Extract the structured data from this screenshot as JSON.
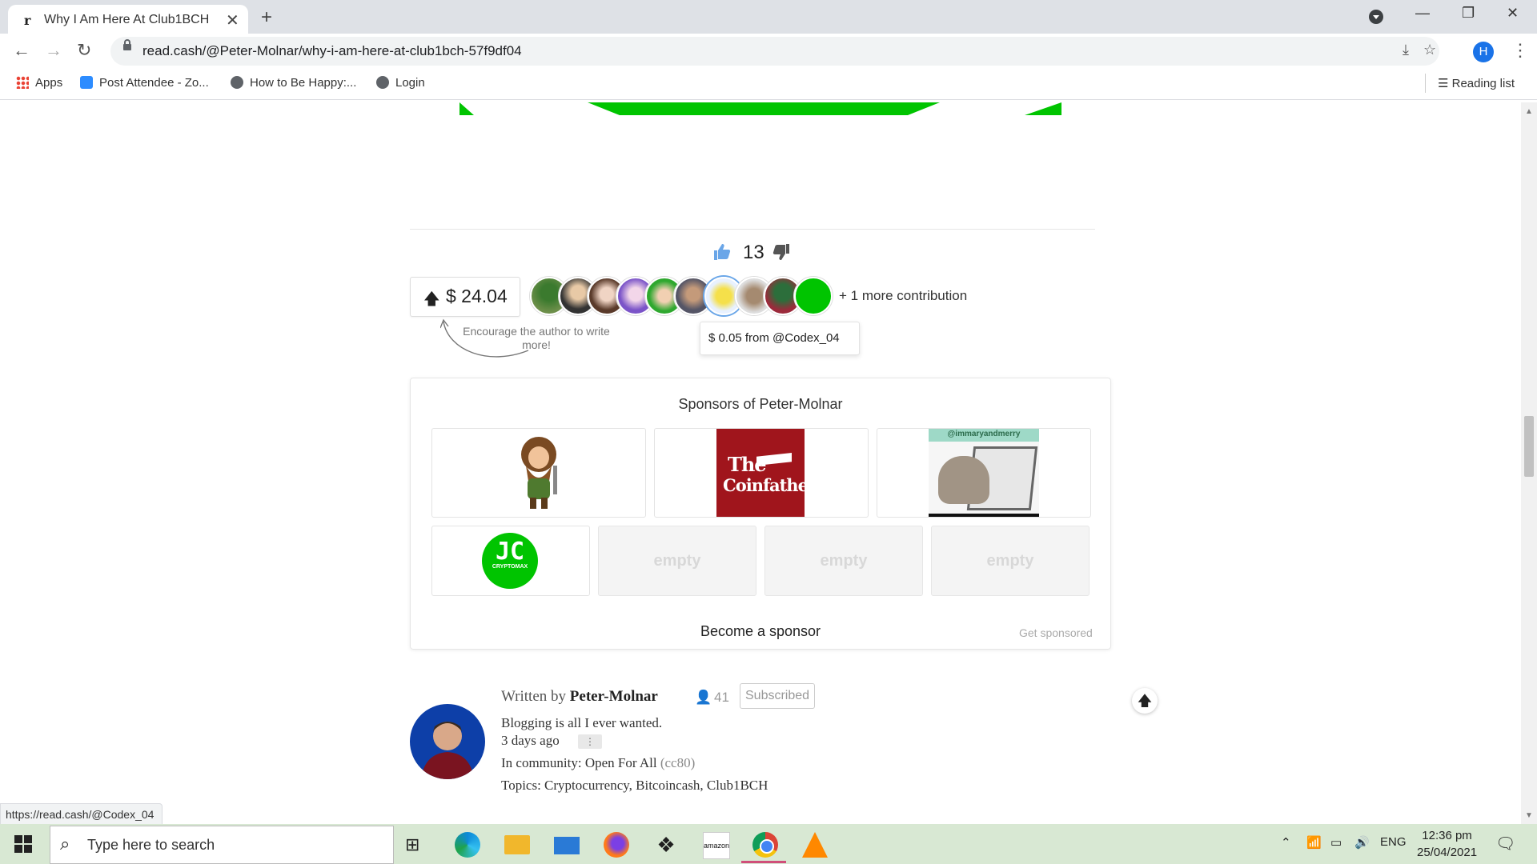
{
  "browser": {
    "tab_title": "Why I Am Here At Club1BCH",
    "tab_favicon": "r",
    "url": "read.cash/@Peter-Molnar/why-i-am-here-at-club1bch-57f9df04",
    "profile_initial": "H",
    "bookmarks": [
      {
        "label": "Apps",
        "icon": "apps-grid-icon"
      },
      {
        "label": "Post Attendee - Zo...",
        "icon": "zoom-icon"
      },
      {
        "label": "How to Be Happy:...",
        "icon": "globe-icon"
      },
      {
        "label": "Login",
        "icon": "globe-icon"
      }
    ],
    "reading_list": "Reading list",
    "status_url": "https://read.cash/@Codex_04"
  },
  "article": {
    "votes": "13",
    "tip_amount": "$ 24.04",
    "encourage_text": "Encourage the author to write more!",
    "more_contributions": "+ 1 more contribution",
    "tooltip": "$ 0.05 from @Codex_04"
  },
  "sponsors": {
    "title": "Sponsors of Peter-Molnar",
    "coinfather_line1": "The",
    "coinfather_line2": "Coinfather",
    "cat_handle": "@immaryandmerry",
    "cryptomax_label": "CRYPTOMAX",
    "empty_label": "empty",
    "become": "Become a sponsor",
    "get_sponsored": "Get sponsored"
  },
  "author": {
    "written_prefix": "Written by",
    "name": "Peter-Molnar",
    "followers": "41",
    "subscribed": "Subscribed",
    "bio": "Blogging is all I ever wanted.",
    "ago": "3 days ago",
    "community_prefix": "In community:",
    "community": "Open For All",
    "community_code": "(cc80)",
    "topics": "Topics: Cryptocurrency, Bitcoincash, Club1BCH"
  },
  "taskbar": {
    "search_placeholder": "Type here to search",
    "lang": "ENG",
    "time": "12:36 pm",
    "date": "25/04/2021"
  },
  "colors": {
    "accent_green": "#00c400",
    "coinfather_red": "#a0151c",
    "taskbar": "#d8e8d3",
    "chrome_blue": "#1a73e8"
  }
}
